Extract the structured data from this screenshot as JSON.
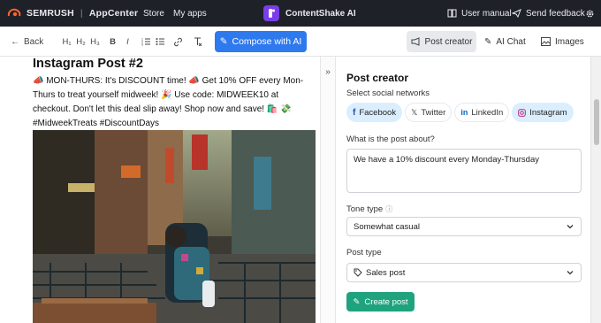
{
  "topbar": {
    "brand": "SEMRUSH",
    "separator": "|",
    "section": "AppCenter",
    "nav_store": "Store",
    "nav_myapps": "My apps",
    "app_name": "ContentShake AI",
    "user_manual": "User manual",
    "send_feedback": "Send feedback"
  },
  "toolbar": {
    "back": "Back",
    "h1": "H₁",
    "h2": "H₂",
    "h3": "H₃",
    "bold": "B",
    "italic": "I",
    "compose": "Compose with AI",
    "post_creator": "Post creator",
    "ai_chat": "AI Chat",
    "images": "Images"
  },
  "post": {
    "title": "Instagram Post #2",
    "body": "📣 MON-THURS: It's DISCOUNT time! 📣 Get 10% OFF every Mon-Thurs to treat yourself midweek! 🎉 Use code: MIDWEEK10 at checkout. Don't let this deal slip away! Shop now and save! 🛍️ 💸 #MidweekTreats #DiscountDays"
  },
  "panel": {
    "title": "Post creator",
    "networks_label": "Select social networks",
    "networks": [
      {
        "label": "Facebook",
        "icon": "facebook-icon",
        "selected": true
      },
      {
        "label": "Twitter",
        "icon": "twitter-icon",
        "selected": false
      },
      {
        "label": "LinkedIn",
        "icon": "linkedin-icon",
        "selected": false
      },
      {
        "label": "Instagram",
        "icon": "instagram-icon",
        "selected": true
      }
    ],
    "about_label": "What is the post about?",
    "about_value": "We have a 10% discount every Monday-Thursday",
    "tone_label": "Tone type",
    "tone_value": "Somewhat casual",
    "post_type_label": "Post type",
    "post_type_value": "Sales post",
    "create_button": "Create post"
  },
  "colors": {
    "topbar_bg": "#1e2128",
    "compose_blue": "#2f79ee",
    "create_green": "#1fa37e",
    "chip_selected": "#dbeefd",
    "brand_orange": "#ff642d",
    "app_purple": "#7a3dea"
  }
}
